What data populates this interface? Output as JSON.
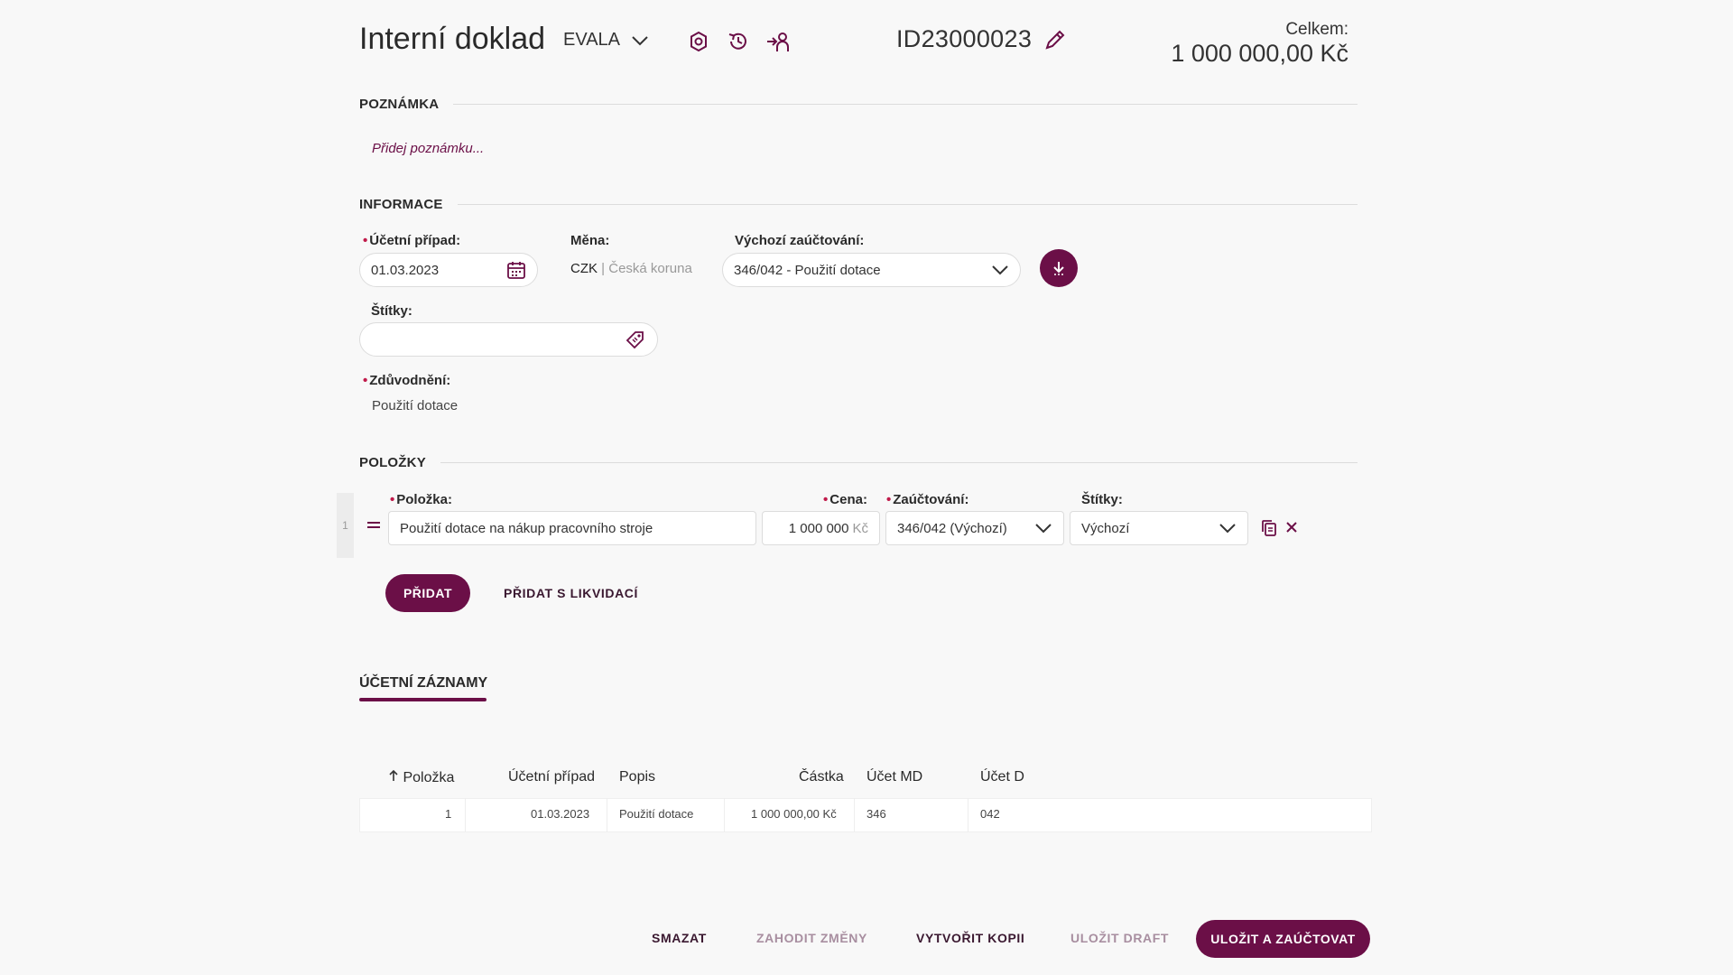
{
  "header": {
    "title": "Interní doklad",
    "company": "EVALA",
    "doc_id": "ID23000023",
    "total_label": "Celkem:",
    "total_value": "1 000 000,00 Kč",
    "icons": [
      "settings-icon",
      "history-icon",
      "assign-user-icon",
      "edit-icon"
    ]
  },
  "note": {
    "title": "POZNÁMKA",
    "placeholder": "Přidej poznámku..."
  },
  "info": {
    "title": "INFORMACE",
    "accounting_case_label": "Účetní případ:",
    "accounting_case_value": "01.03.2023",
    "currency_label": "Měna:",
    "currency_code": "CZK",
    "currency_name": "| Česká koruna",
    "default_posting_label": "Výchozí zaúčtování:",
    "default_posting_value": "346/042 - Použití dotace",
    "tags_label": "Štítky:",
    "tags_value": "",
    "reason_label": "Zdůvodnění:",
    "reason_value": "Použití dotace"
  },
  "items": {
    "title": "POLOŽKY",
    "col_item": "Položka:",
    "col_price": "Cena:",
    "col_posting": "Zaúčtování:",
    "col_tags": "Štítky:",
    "rows": [
      {
        "index": "1",
        "item": "Použití dotace na nákup pracovního stroje",
        "price": "1 000 000",
        "price_unit": "Kč",
        "posting": "346/042 (Výchozí)",
        "tags": "Výchozí"
      }
    ],
    "add_button": "PŘIDAT",
    "add_with_liquidation": "PŘIDAT S LIKVIDACÍ"
  },
  "records": {
    "tab": "ÚČETNÍ ZÁZNAMY",
    "columns": [
      "Položka",
      "Účetní případ",
      "Popis",
      "Částka",
      "Účet MD",
      "Účet D"
    ],
    "rows": [
      [
        "1",
        "01.03.2023",
        "Použití dotace",
        "1 000 000,00 Kč",
        "346",
        "042"
      ]
    ]
  },
  "footer": {
    "delete": "SMAZAT",
    "discard": "ZAHODIT ZMĚNY",
    "copy": "VYTVOŘIT KOPII",
    "save_draft": "ULOŽIT DRAFT",
    "save_post": "ULOŽIT A ZAÚČTOVAT"
  },
  "colors": {
    "brand": "#6b0f47",
    "required": "#c01a4a",
    "background": "#f8f8f8"
  }
}
